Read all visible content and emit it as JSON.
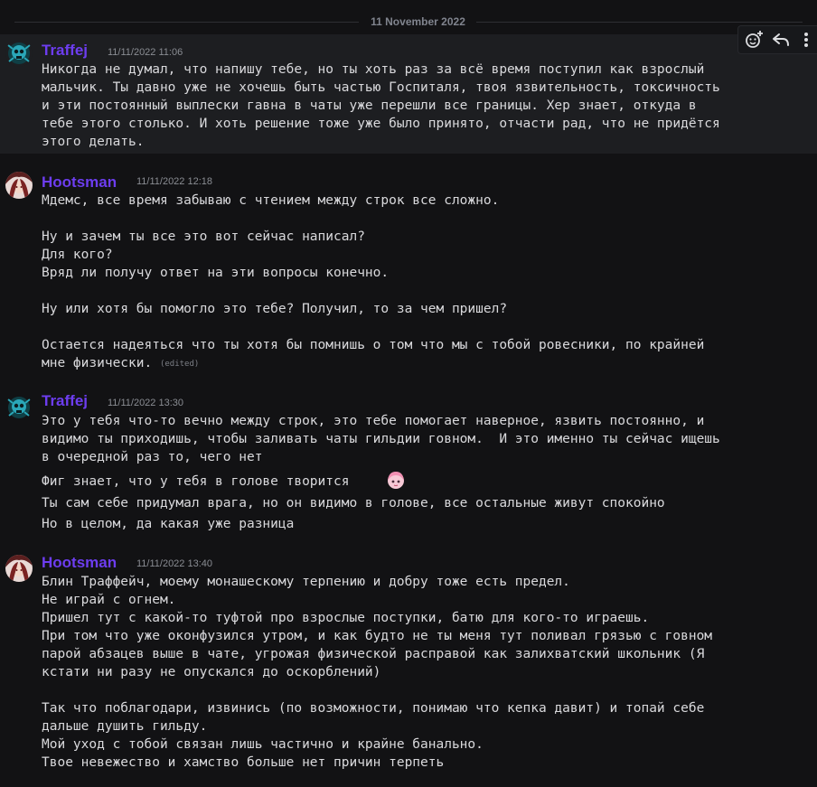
{
  "date_divider": "11 November 2022",
  "hover_actions": [
    "add-reaction-icon",
    "reply-icon",
    "more-icon"
  ],
  "messages": [
    {
      "author": "Traffej",
      "timestamp": "11/11/2022 11:06",
      "lines": [
        "Никогда не думал, что напишу тебе, но ты хоть раз за всё время поступил как взрослый",
        "мальчик. Ты давно уже не хочешь быть частью Госпиталя, твоя язвительность, токсичность",
        "и эти постоянный выплески гавна в чаты уже перешли все границы. Хер знает, откуда в",
        "тебе этого столько. И хоть решение тоже уже было принято, отчасти рад, что не придётся",
        "этого делать."
      ]
    },
    {
      "author": "Hootsman",
      "timestamp": "11/11/2022 12:18",
      "lines": [
        "Мдемс, все время забываю с чтением между строк все сложно.",
        "",
        "Ну и зачем ты все это вот сейчас написал?",
        "Для кого?",
        "Вряд ли получу ответ на эти вопросы конечно.",
        "",
        "Ну или хотя бы помогло это тебе? Получил, то за чем пришел?",
        "",
        "Остается надеяться что ты хотя бы помнишь о том что мы с тобой ровесники, по крайней",
        "мне физически."
      ],
      "edited": "(edited)"
    },
    {
      "author": "Traffej",
      "timestamp": "11/11/2022 13:30",
      "lines": [
        "Это у тебя что-то вечно между строк, это тебе помогает наверное, язвить постоянно, и",
        "видимо ты приходишь, чтобы заливать чаты гильдии говном.  И это именно ты сейчас ищешь",
        "в очередной раз то, чего нет"
      ],
      "followups": [
        "Фиг знает, что у тебя в голове творится",
        "Ты сам себе придумал врага, но он видимо в голове, все остальные живут спокойно",
        "Но в целом, да какая уже разница"
      ]
    },
    {
      "author": "Hootsman",
      "timestamp": "11/11/2022 13:40",
      "lines": [
        "Блин Траффейч, моему монашескому терпению и добру тоже есть предел.",
        "Не играй с огнем.",
        "Пришел тут с какой-то туфтой про взрослые поступки, батю для кого-то играешь.",
        "При том что уже оконфузился утром, и как будто не ты меня тут поливал грязью с говном",
        "парой абзацев выше в чате, угрожая физической расправой как залихватский школьник (Я",
        "кстати ни разу не опускался до оскорблений)",
        "",
        "Так что поблагодари, извинись (по возможности, понимаю что кепка давит) и топай себе",
        "дальше душить гильду.",
        "Мой уход с тобой связан лишь частично и крайне банально.",
        "Твое невежество и хамство больше нет причин терпеть"
      ]
    }
  ]
}
